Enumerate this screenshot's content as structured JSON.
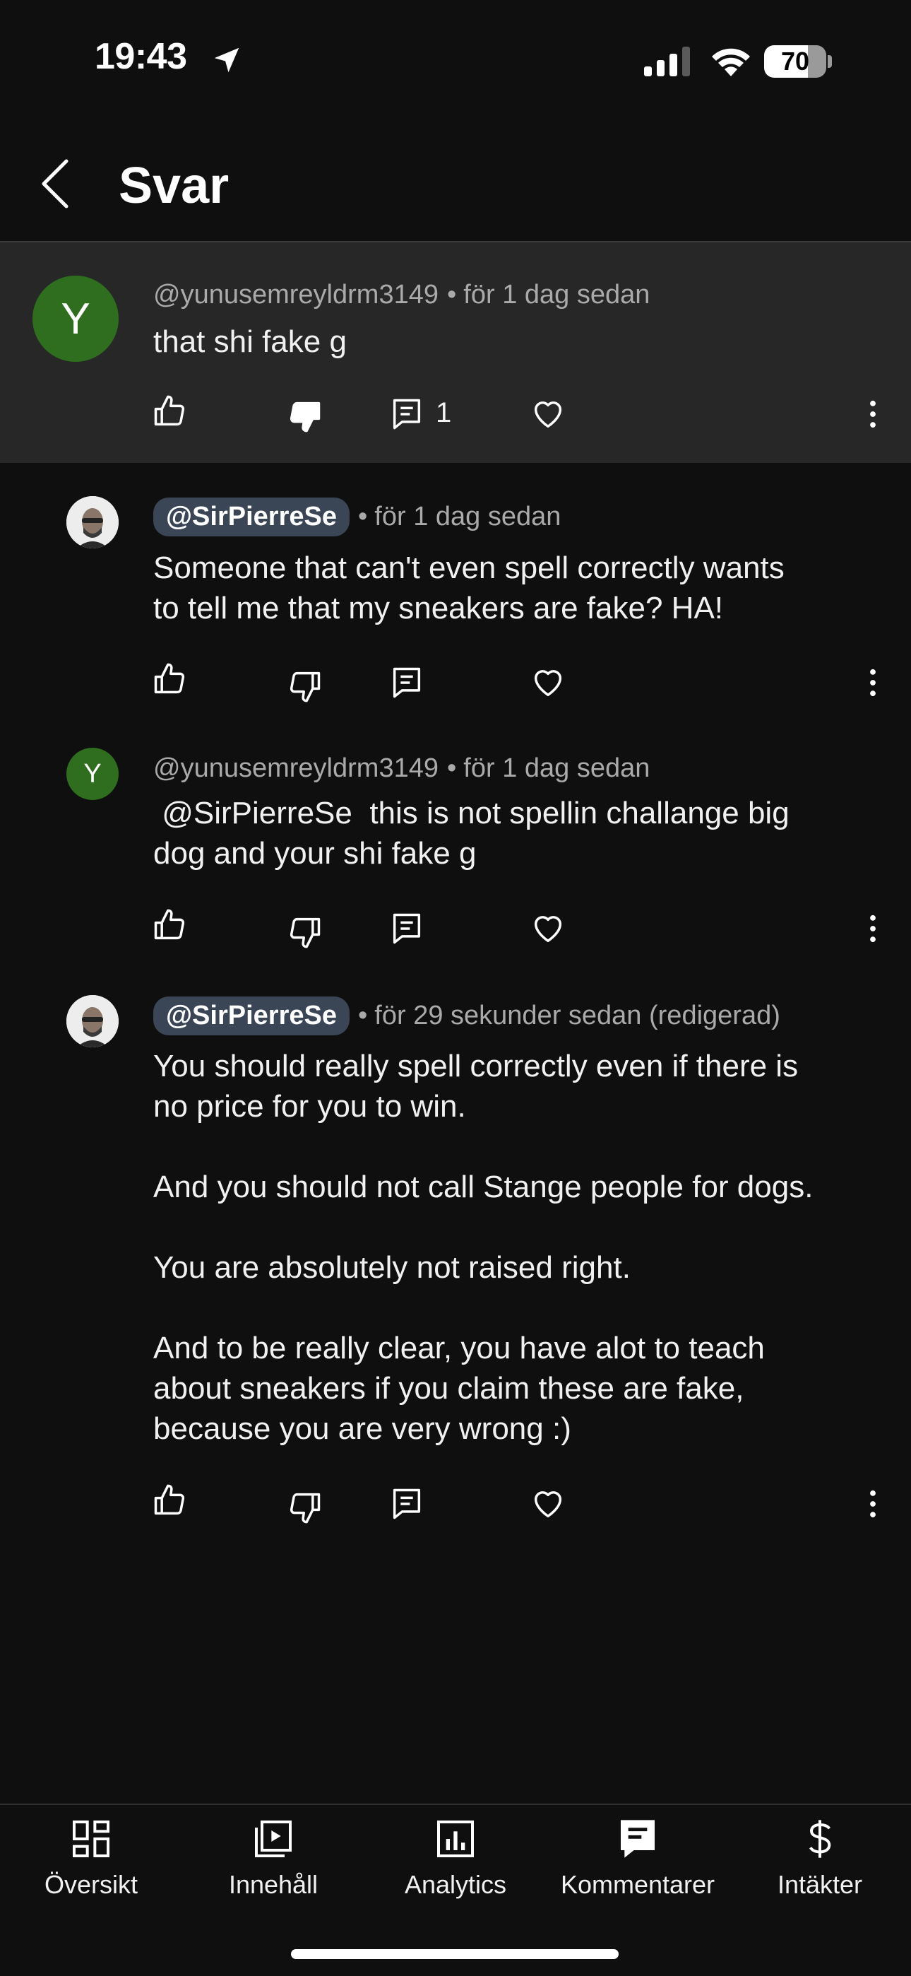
{
  "status_bar": {
    "time": "19:43",
    "battery": "70",
    "battery_level": 0.7
  },
  "header": {
    "title": "Svar"
  },
  "parent_comment": {
    "avatar_letter": "Y",
    "author": "@yunusemreyldrm3149",
    "time": "för 1 dag sedan",
    "text": "that shi fake g",
    "reply_count": "1"
  },
  "replies": [
    {
      "author": "@SirPierreSe",
      "time": "för 1 dag sedan",
      "text": "Someone that can't even spell correctly wants\nto tell me that my sneakers are fake? HA!"
    },
    {
      "avatar_letter": "Y",
      "author": "@yunusemreyldrm3149",
      "time": "för 1 dag sedan",
      "text": " @SirPierreSe  this is not spellin challange big\ndog and your shi fake g"
    },
    {
      "author": "@SirPierreSe",
      "time": "för 29 sekunder sedan (redigerad)",
      "text": "You should really spell correctly even if there is\nno price for you to win.\n\nAnd you should not call Stange people for dogs.\n\nYou are absolutely not raised right.\n\nAnd to be really clear, you have alot to teach\nabout sneakers if you claim these are fake,\nbecause you are very wrong :)"
    }
  ],
  "bottom_nav": [
    {
      "label": "Översikt",
      "icon": "dashboard-icon"
    },
    {
      "label": "Innehåll",
      "icon": "content-icon"
    },
    {
      "label": "Analytics",
      "icon": "analytics-icon"
    },
    {
      "label": "Kommentarer",
      "icon": "comments-icon"
    },
    {
      "label": "Intäkter",
      "icon": "dollar-icon"
    }
  ],
  "colors": {
    "background": "#0f0f0f",
    "highlight": "#272727",
    "avatar_green": "#2e6e1e",
    "mention_chip": "#3a4555"
  }
}
